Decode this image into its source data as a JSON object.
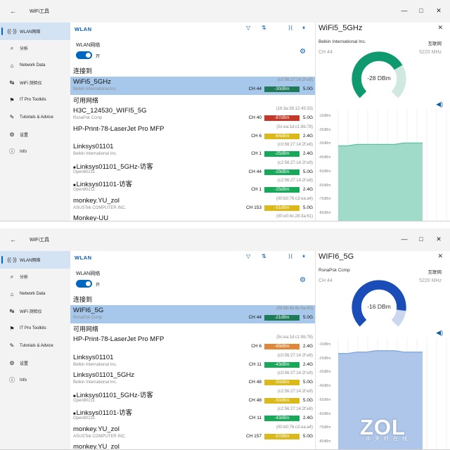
{
  "app_title": "WiFi工具",
  "window_controls": {
    "minimize": "—",
    "maximize": "□",
    "close": "✕"
  },
  "sidebar": [
    {
      "icon": "wifi-icon",
      "glyph": "((·))",
      "label": "WLAN网络"
    },
    {
      "icon": "analysis-icon",
      "glyph": "⌕",
      "label": "分析"
    },
    {
      "icon": "network-data-icon",
      "glyph": "⌂",
      "label": "Network Data"
    },
    {
      "icon": "wifi-tester-icon",
      "glyph": "↹",
      "label": "WiFi 测验仪"
    },
    {
      "icon": "toolkit-icon",
      "glyph": "⚑",
      "label": "IT Pro Toolkits"
    },
    {
      "icon": "tutorial-icon",
      "glyph": "✎",
      "label": "Tutorials & Advice"
    },
    {
      "icon": "settings-icon",
      "glyph": "⚙",
      "label": "设置"
    },
    {
      "icon": "info-icon",
      "glyph": "ⓘ",
      "label": "Info"
    }
  ],
  "colors": {
    "accent": "#0067c0",
    "selected": "#a7c8ea",
    "green": "#17a85a",
    "teal": "#1f7a5a",
    "yellow": "#d9b91b",
    "orange": "#e0883a",
    "red": "#c0392b",
    "gauge1": "#0e9a6e",
    "gauge2": "#1a4db8",
    "graph1": "#9fdbc8",
    "graph2": "#aec6ea"
  },
  "toolbar_icons": [
    "filter-icon",
    "sort-icon",
    "expand-icon",
    "refresh-icon",
    "pause-icon"
  ],
  "windows": [
    {
      "main": {
        "header": "WLAN",
        "switch_label": "WLAN网络",
        "switch_state": "开",
        "connected_title": "连接到",
        "available_title": "可用网络",
        "connected": {
          "name": "WiFi5_5GHz",
          "vendor": "Belkin International Inc.",
          "mac": "(c0:56:27:14:2f:e9)",
          "channel": "CH 44",
          "signal": "-30dBm",
          "signal_color": "#1f7a5a",
          "band": "5.0G"
        },
        "networks": [
          {
            "name": "H3C_124530_WIFI5_5G",
            "vendor": "RsnaPsk Ccmp",
            "mac": "(16:3a:38:12:45:33)",
            "channel": "CH 40",
            "signal": "-87dBm",
            "signal_color": "#c0392b",
            "band": "5.0G",
            "lock": false
          },
          {
            "name": "HP-Print-78-LaserJet Pro MFP",
            "vendor": "",
            "mac": "(5c:ea:1d:c1:8b:78)",
            "channel": "CH 6",
            "signal": "-64dBm",
            "signal_color": "#d9b91b",
            "band": "2.4G",
            "lock": false
          },
          {
            "name": "Linksys01101",
            "vendor": "Belkin International Inc.",
            "mac": "(c0:56:27:14:2f:e8)",
            "channel": "CH 1",
            "signal": "-25dBm",
            "signal_color": "#17a85a",
            "band": "2.4G",
            "lock": false
          },
          {
            "name": "Linksys01101_5GHz-访客",
            "vendor": "Open80211",
            "mac": "(c2:56:27:14:2f:e9)",
            "channel": "CH 44",
            "signal": "-29dBm",
            "signal_color": "#17a85a",
            "band": "5.0G",
            "lock": true
          },
          {
            "name": "Linksys01101-访客",
            "vendor": "Open80211",
            "mac": "(c2:56:27:14:2f:e8)",
            "channel": "CH 1",
            "signal": "-25dBm",
            "signal_color": "#17a85a",
            "band": "2.4G",
            "lock": true
          },
          {
            "name": "monkey.YU_zol",
            "vendor": "ASUSTek COMPUTER INC.",
            "mac": "(00:b0:76:c3:ea:a4)",
            "channel": "CH 153",
            "signal": "-51dBm",
            "signal_color": "#d9b91b",
            "band": "5.0G",
            "lock": false
          },
          {
            "name": "Monkey-UU",
            "vendor": "",
            "mac": "(00:e0:4c:28:3a:61)",
            "channel": "",
            "signal": "",
            "signal_color": "#ffffff",
            "band": "",
            "lock": false
          }
        ]
      },
      "detail": {
        "name": "WiFi5_5GHz",
        "vendor": "Belkin International Inc.",
        "security": "互联网",
        "channel": "CH 44",
        "frequency": "5220 MHz",
        "signal_text": "-28 DBm",
        "signal_fraction": 0.72,
        "gauge_color": "#0e9a6e",
        "gauge_track": "#cfe9e1",
        "graph_color": "#9fdbc8",
        "graph_line": "#5cbfa1",
        "graph_values": [
          -31,
          -31,
          -30,
          -30,
          -30,
          -30,
          -30,
          -29,
          -29,
          -29
        ],
        "graph_range": [
          -85,
          -5
        ],
        "graph_labels": [
          "-10dBm",
          "-20dBm",
          "-30dBm",
          "-40dBm",
          "-50dBm",
          "-60dBm",
          "-70dBm",
          "-80dBm"
        ]
      }
    },
    {
      "main": {
        "header": "WLAN",
        "switch_label": "WLAN网络",
        "switch_state": "开",
        "connected_title": "连接到",
        "available_title": "可用网络",
        "connected": {
          "name": "WIFI6_5G",
          "vendor": "RsnaPsk Ccmp",
          "mac": "(08:9b:4b:6c:5e:40)",
          "channel": "CH 44",
          "signal": "-21dBm",
          "signal_color": "#1f7a5a",
          "band": "5.0G"
        },
        "networks": [
          {
            "name": "HP-Print-78-LaserJet Pro MFP",
            "vendor": "",
            "mac": "(5c:ea:1d:c1:8b:78)",
            "channel": "CH 6",
            "signal": "-69dBm",
            "signal_color": "#e0883a",
            "band": "2.4G",
            "lock": false
          },
          {
            "name": "Linksys01101",
            "vendor": "Belkin International Inc.",
            "mac": "(c0:56:27:14:2f:e8)",
            "channel": "CH 11",
            "signal": "-43dBm",
            "signal_color": "#17a85a",
            "band": "2.4G",
            "lock": false
          },
          {
            "name": "Linksys01101_5GHz",
            "vendor": "Belkin International Inc.",
            "mac": "(c0:56:27:14:2f:e9)",
            "channel": "CH 48",
            "signal": "-50dBm",
            "signal_color": "#d9b91b",
            "band": "5.0G",
            "lock": false
          },
          {
            "name": "Linksys01101_5GHz-访客",
            "vendor": "Open80211",
            "mac": "(c2:56:27:14:2f:e9)",
            "channel": "CH 48",
            "signal": "-50dBm",
            "signal_color": "#d9b91b",
            "band": "5.0G",
            "lock": true
          },
          {
            "name": "Linksys01101-访客",
            "vendor": "Open80211",
            "mac": "(c2:56:27:14:2f:e8)",
            "channel": "CH 11",
            "signal": "-43dBm",
            "signal_color": "#17a85a",
            "band": "2.4G",
            "lock": true
          },
          {
            "name": "monkey.YU_zol",
            "vendor": "ASUSTek COMPUTER INC.",
            "mac": "(00:b0:76:c3:ea:a4)",
            "channel": "CH 157",
            "signal": "-57dBm",
            "signal_color": "#d9b91b",
            "band": "5.0G",
            "lock": false
          },
          {
            "name": "monkey.YU_zol",
            "vendor": "",
            "mac": "",
            "channel": "",
            "signal": "",
            "signal_color": "#ffffff",
            "band": "",
            "lock": false
          }
        ]
      },
      "detail": {
        "name": "WIFI6_5G",
        "vendor": "RsnaPsk Ccmp",
        "security": "互联网",
        "channel": "CH 44",
        "frequency": "5220 MHz",
        "signal_text": "-16 DBm",
        "signal_fraction": 0.86,
        "gauge_color": "#1a4db8",
        "gauge_track": "#cbd7ef",
        "graph_color": "#aec6ea",
        "graph_line": "#7fa3da",
        "graph_values": [
          -16,
          -16,
          -15,
          -15,
          -14,
          -14,
          -14,
          -15,
          -15,
          -15
        ],
        "graph_range": [
          -85,
          -5
        ],
        "graph_labels": [
          "-10dBm",
          "-20dBm",
          "-30dBm",
          "-40dBm",
          "-50dBm",
          "-60dBm",
          "-70dBm",
          "-80dBm"
        ]
      }
    }
  ],
  "watermark": {
    "logo": "ZOL",
    "sub": "中关村在线"
  }
}
